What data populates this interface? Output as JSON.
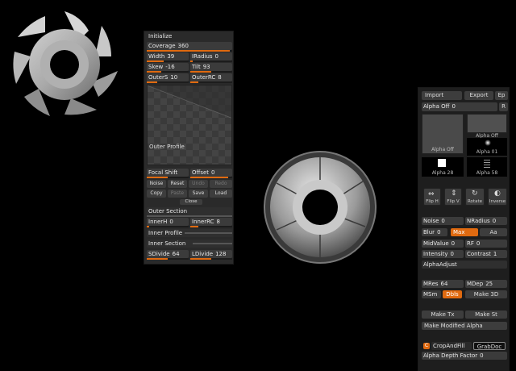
{
  "initialize_panel": {
    "title": "Initialize",
    "coverage": {
      "label": "Coverage",
      "value": "360",
      "fill": 0.97
    },
    "width": {
      "label": "Width",
      "value": "39",
      "fill": 0.4
    },
    "iradius": {
      "label": "IRadius",
      "value": "0",
      "fill": 0.05
    },
    "skew": {
      "label": "Skew",
      "value": "-16",
      "fill": 0.35
    },
    "tilt": {
      "label": "Tilt",
      "value": "93",
      "fill": 0.5
    },
    "outers": {
      "label": "OuterS",
      "value": "10",
      "fill": 0.25
    },
    "outerrc": {
      "label": "OuterRC",
      "value": "8",
      "fill": 0.2
    },
    "outer_profile_label": "Outer Profile",
    "focal_shift": {
      "label": "Focal Shift",
      "value": ""
    },
    "offset": {
      "label": "Offset",
      "value": "0"
    },
    "noise_label": "Noise",
    "reset_label": "Reset",
    "undo_label": "Undo",
    "redo_label": "Redo",
    "copy_label": "Copy",
    "paste_label": "Paste",
    "save_label": "Save",
    "load_label": "Load",
    "close_label": "Close",
    "outer_section_label": "Outer Section",
    "innerh": {
      "label": "InnerH",
      "value": "0",
      "fill": 0.05
    },
    "innerrc": {
      "label": "InnerRC",
      "value": "8",
      "fill": 0.2
    },
    "inner_profile_label": "Inner Profile",
    "inner_section_label": "Inner Section",
    "sdivide": {
      "label": "SDivide",
      "value": "64",
      "fill": 0.5
    },
    "ldivide": {
      "label": "LDivide",
      "value": "128",
      "fill": 0.5
    }
  },
  "alpha_panel": {
    "import_label": "Import",
    "export_label": "Export",
    "ep_label": "Ep",
    "alpha_off_label": "Alpha Off",
    "alpha_off_value": "0",
    "r_label": "R",
    "thumbs": [
      {
        "label": "Alpha Off"
      },
      {
        "label": "Alpha Off"
      },
      {
        "label": "Alpha 01"
      },
      {
        "label": "Alpha 28"
      },
      {
        "label": "Alpha 58"
      }
    ],
    "flip_h_label": "Flip H",
    "flip_v_label": "Flip V",
    "rotate_label": "Rotate",
    "inverse_label": "Inverse",
    "noise": {
      "label": "Noise",
      "value": "0",
      "fill": 0.05
    },
    "nradius": {
      "label": "NRadius",
      "value": "0",
      "fill": 0.05
    },
    "blur": {
      "label": "Blur",
      "value": "0",
      "fill": 0.05
    },
    "max_label": "Max",
    "aa_label": "Aa",
    "midvalue": {
      "label": "MidValue",
      "value": "0",
      "fill": 0.05
    },
    "rf": {
      "label": "RF",
      "value": "0",
      "fill": 0.05
    },
    "intensity": {
      "label": "Intensity",
      "value": "0",
      "fill": 0.05
    },
    "contrast": {
      "label": "Contrast",
      "value": "1",
      "fill": 0.1
    },
    "alpha_adjust_label": "AlphaAdjust",
    "mres": {
      "label": "MRes",
      "value": "64",
      "fill": 0.5
    },
    "mdep": {
      "label": "MDep",
      "value": "25",
      "fill": 0.3
    },
    "msm_label": "MSm",
    "dbls_label": "Dbls",
    "make3d_label": "Make 3D",
    "make_tx_label": "Make Tx",
    "make_st_label": "Make St",
    "make_modified_alpha_label": "Make Modified Alpha",
    "crop_and_fill_label": "CropAndFill",
    "grab_doc_label": "GrabDoc",
    "alpha_depth_factor": {
      "label": "Alpha Depth Factor",
      "value": "0"
    }
  },
  "colors": {
    "accent": "#e06a10",
    "panel": "#2a2a2a",
    "row": "#3b3b3b"
  }
}
